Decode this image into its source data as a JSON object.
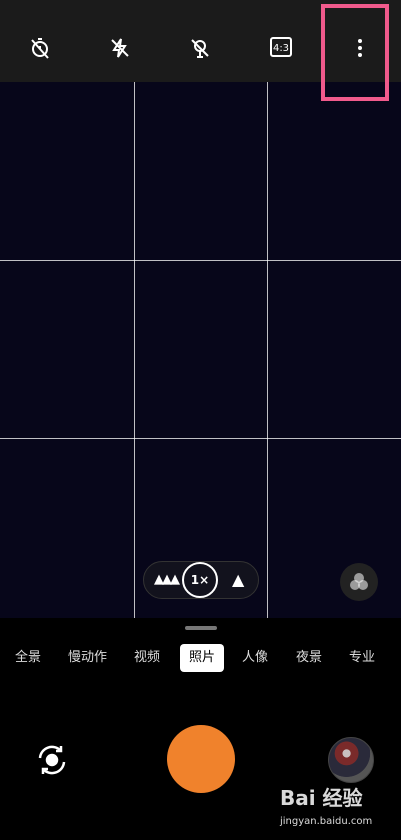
{
  "top_bar": {
    "icons": [
      "timer-off-icon",
      "flash-off-icon",
      "live-photo-off-icon",
      "aspect-ratio-icon",
      "more-options-icon"
    ],
    "aspect_ratio_label": "4:3"
  },
  "zoom": {
    "wide_icon": "trees-icon",
    "current": "1×",
    "tele_icon": "tree-icon"
  },
  "modes": {
    "items": [
      "全景",
      "慢动作",
      "视频",
      "照片",
      "人像",
      "夜景",
      "专业"
    ],
    "selected": "照片"
  },
  "watermark": {
    "logo": "Bai 经验",
    "url": "jingyan.baidu.com"
  },
  "colors": {
    "shutter": "#f0822c",
    "highlight_box": "#f05a8c",
    "viewfinder": "#07061a"
  }
}
